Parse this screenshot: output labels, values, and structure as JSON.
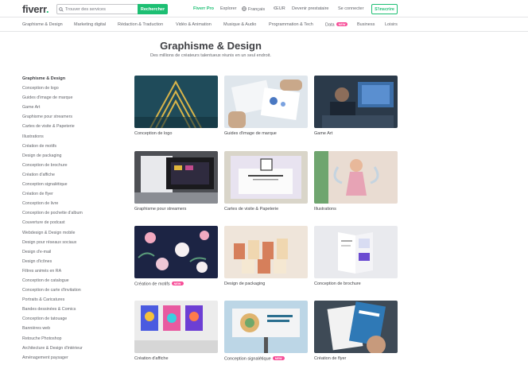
{
  "header": {
    "logo": "fiverr",
    "logo_dot": ".",
    "search_placeholder": "Trouver des services",
    "search_button": "Rechercher",
    "nav": {
      "pro": "Fiverr Pro",
      "explore": "Explorer",
      "language": "Français",
      "currency": "€EUR",
      "become_seller": "Devenir prestataire",
      "signin": "Se connecter",
      "join": "S'inscrire"
    }
  },
  "categories": [
    "Graphisme & Design",
    "Marketing digital",
    "Rédaction & Traduction",
    "Vidéo & Animation",
    "Musique & Audio",
    "Programmation & Tech",
    "Data",
    "Business",
    "Loisirs"
  ],
  "new_badge": "NEW",
  "page": {
    "title": "Graphisme & Design",
    "subtitle": "Des millions de créateurs talentueux réunis en un seul endroit."
  },
  "sidebar": {
    "title": "Graphisme & Design",
    "items": [
      "Conception de logo",
      "Guides d'image de marque",
      "Game Art",
      "Graphisme pour streamers",
      "Cartes de visite & Papeterie",
      "Illustrations",
      "Création de motifs",
      "Design de packaging",
      "Conception de brochure",
      "Création d'affiche",
      "Conception signalétique",
      "Création de flyer",
      "Conception de livre",
      "Conception de pochette d'album",
      "Couverture de podcast",
      "Webdesign & Design mobile",
      "Design pour réseaux sociaux",
      "Design d'e-mail",
      "Design d'icônes",
      "Filtres animés en RA",
      "Conception de catalogue",
      "Conception de carte d'invitation",
      "Portraits & Caricatures",
      "Bandes dessinées & Comics",
      "Conception de tatouage",
      "Bannières web",
      "Retouche Photoshop",
      "Architecture & Design d'intérieur",
      "Aménagement paysager"
    ]
  },
  "cards": [
    {
      "label": "Conception de logo"
    },
    {
      "label": "Guides d'image de marque"
    },
    {
      "label": "Game Art"
    },
    {
      "label": "Graphisme pour streamers"
    },
    {
      "label": "Cartes de visite & Papeterie"
    },
    {
      "label": "Illustrations"
    },
    {
      "label": "Création de motifs",
      "badge": "NEW"
    },
    {
      "label": "Design de packaging"
    },
    {
      "label": "Conception de brochure"
    },
    {
      "label": "Création d'affiche"
    },
    {
      "label": "Conception signalétique",
      "badge": "NEW"
    },
    {
      "label": "Création de flyer"
    }
  ],
  "colors": {
    "brand_green": "#1dbf73",
    "new_badge": "#f74c97",
    "text": "#404145",
    "muted": "#62646a"
  },
  "icons": [
    "search-icon",
    "globe-icon"
  ]
}
